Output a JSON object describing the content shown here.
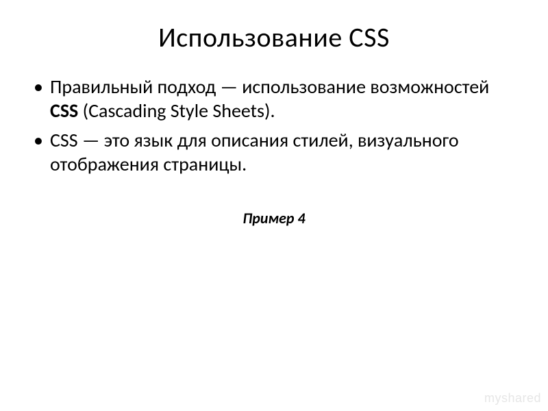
{
  "slide": {
    "title": "Использование CSS",
    "bullets": [
      {
        "pre": "Правильный подход — использование возможностей ",
        "strong": "CSS",
        "post": " (Cascading Style Sheets)."
      },
      {
        "pre": "CSS — это язык для описания стилей, визуального отображения страницы.",
        "strong": "",
        "post": ""
      }
    ],
    "example_label": "Пример 4",
    "watermark": "myshared"
  }
}
